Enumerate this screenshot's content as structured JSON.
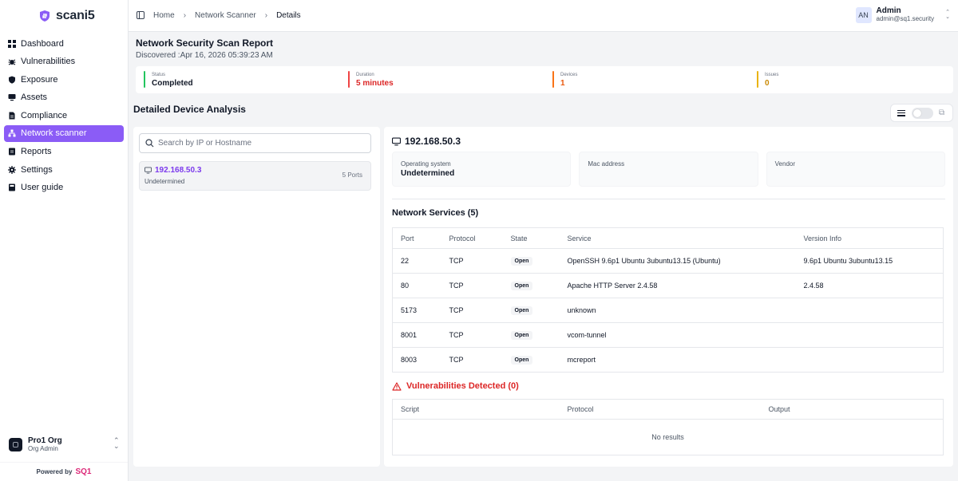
{
  "brand": {
    "name": "scani5"
  },
  "sidebar": {
    "items": [
      {
        "label": "Dashboard",
        "icon": "dashboard-icon"
      },
      {
        "label": "Vulnerabilities",
        "icon": "bug-icon"
      },
      {
        "label": "Exposure",
        "icon": "shield-icon"
      },
      {
        "label": "Assets",
        "icon": "monitor-icon"
      },
      {
        "label": "Compliance",
        "icon": "document-icon"
      },
      {
        "label": "Network scanner",
        "icon": "network-icon",
        "active": true
      },
      {
        "label": "Reports",
        "icon": "report-icon"
      },
      {
        "label": "Settings",
        "icon": "gear-icon"
      },
      {
        "label": "User guide",
        "icon": "book-icon"
      }
    ]
  },
  "org": {
    "name": "Pro1 Org",
    "role": "Org Admin"
  },
  "footer": {
    "powered_by": "Powered by",
    "logo_text": "SQ1"
  },
  "header": {
    "breadcrumb": [
      "Home",
      "Network Scanner",
      "Details"
    ],
    "user": {
      "initials": "AN",
      "name": "Admin",
      "email": "admin@sq1.security"
    }
  },
  "report": {
    "title": "Network Security Scan Report",
    "discovered": "Discovered :Apr 16, 2026 05:39:23 AM"
  },
  "stats": [
    {
      "label": "Status",
      "value": "Completed",
      "color": "#22c55e",
      "value_color": "#111827"
    },
    {
      "label": "Duration",
      "value": "5 minutes",
      "color": "#ef4444",
      "value_color": "#dc2626"
    },
    {
      "label": "Devices",
      "value": "1",
      "color": "#f97316",
      "value_color": "#ea580c"
    },
    {
      "label": "Issues",
      "value": "0",
      "color": "#eab308",
      "value_color": "#ca8a04"
    }
  ],
  "section": {
    "title": "Detailed Device Analysis"
  },
  "search": {
    "placeholder": "Search by IP or Hostname"
  },
  "device": {
    "ip": "192.168.50.3",
    "os": "Undetermined",
    "ports": "5 Ports"
  },
  "details": {
    "ip": "192.168.50.3",
    "info": [
      {
        "label": "Operating system",
        "value": "Undetermined"
      },
      {
        "label": "Mac address",
        "value": ""
      },
      {
        "label": "Vendor",
        "value": ""
      }
    ],
    "services_title": "Network Services (5)",
    "services_columns": [
      "Port",
      "Protocol",
      "State",
      "Service",
      "Version Info"
    ],
    "services": [
      {
        "port": "22",
        "protocol": "TCP",
        "state": "Open",
        "service": "OpenSSH 9.6p1 Ubuntu 3ubuntu13.15 (Ubuntu)",
        "version": "9.6p1 Ubuntu 3ubuntu13.15"
      },
      {
        "port": "80",
        "protocol": "TCP",
        "state": "Open",
        "service": "Apache HTTP Server 2.4.58",
        "version": "2.4.58"
      },
      {
        "port": "5173",
        "protocol": "TCP",
        "state": "Open",
        "service": "unknown",
        "version": ""
      },
      {
        "port": "8001",
        "protocol": "TCP",
        "state": "Open",
        "service": "vcom-tunnel",
        "version": ""
      },
      {
        "port": "8003",
        "protocol": "TCP",
        "state": "Open",
        "service": "mcreport",
        "version": ""
      }
    ],
    "vuln_title": "Vulnerabilities Detected (0)",
    "vuln_columns": [
      "Script",
      "Protocol",
      "Output"
    ],
    "vuln_empty": "No results"
  }
}
